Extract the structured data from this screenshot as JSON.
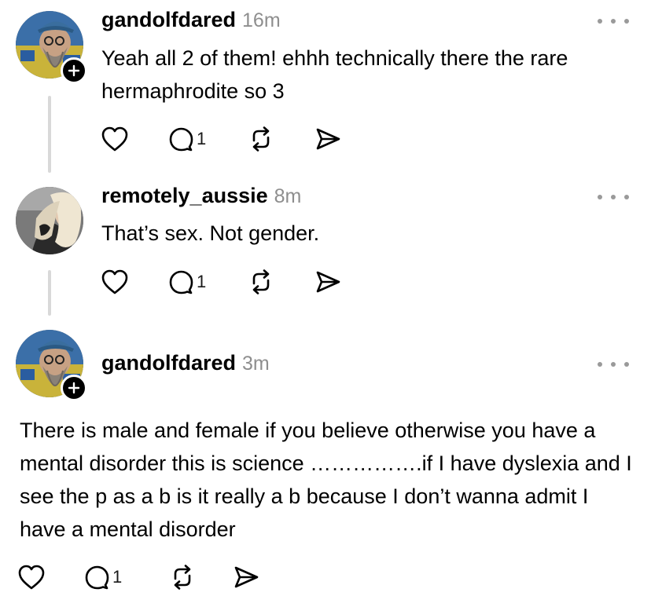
{
  "posts": [
    {
      "username": "gandolfdared",
      "time": "16m",
      "text": "Yeah all 2 of them! ehhh technically there the rare hermaphrodite so 3",
      "reply_count": "1",
      "has_follow_badge": true
    },
    {
      "username": "remotely_aussie",
      "time": "8m",
      "text": "That’s sex. Not gender.",
      "reply_count": "1",
      "has_follow_badge": false
    },
    {
      "username": "gandolfdared",
      "time": "3m",
      "text": "There is male and female if you believe otherwise you have a mental disorder this is science …………….if I have dyslexia and I see the p as a b is it really a b because I don’t wanna admit I have a mental disorder",
      "reply_count": "1",
      "has_follow_badge": true
    }
  ],
  "icons": {
    "like": "heart-icon",
    "reply": "speech-bubble-icon",
    "repost": "repost-arrows-icon",
    "share": "send-icon",
    "more": "ellipsis-icon",
    "follow": "plus-icon"
  },
  "colors": {
    "text": "#000000",
    "secondary_text": "#8e8e8e",
    "thread_line": "#d9d9d9",
    "badge": "#000000"
  }
}
